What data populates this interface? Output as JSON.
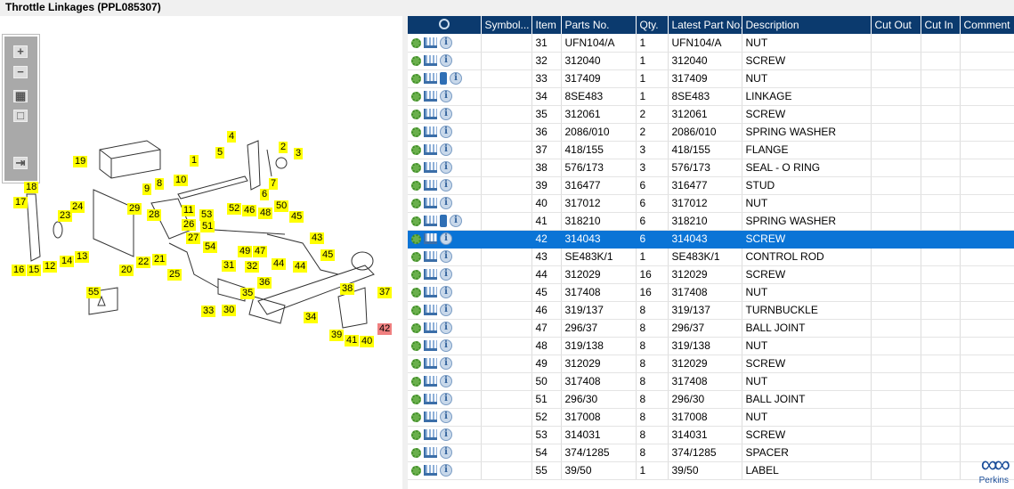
{
  "title": "Throttle Linkages (PPL085307)",
  "tools": {
    "zoom_in": "+",
    "zoom_out": "−",
    "fit": "▦",
    "actual": "□",
    "export": "⇥"
  },
  "callouts": [
    "1",
    "2",
    "3",
    "4",
    "5",
    "6",
    "7",
    "8",
    "9",
    "10",
    "11",
    "12",
    "13",
    "14",
    "15",
    "16",
    "17",
    "18",
    "19",
    "20",
    "21",
    "22",
    "23",
    "24",
    "25",
    "26",
    "27",
    "28",
    "29",
    "30",
    "31",
    "32",
    "33",
    "34",
    "35",
    "36",
    "37",
    "38",
    "39",
    "40",
    "41",
    "42",
    "43",
    "44",
    "44",
    "45",
    "45",
    "46",
    "47",
    "48",
    "49",
    "50",
    "51",
    "52",
    "53",
    "54",
    "55"
  ],
  "selected_callout": "42",
  "columns": [
    "",
    "Symbol...",
    "Item",
    "Parts No.",
    "Qty.",
    "Latest Part No.",
    "Description",
    "Cut Out",
    "Cut In",
    "Comment"
  ],
  "rows": [
    {
      "item": "31",
      "part": "UFN104/A",
      "qty": "1",
      "latest": "UFN104/A",
      "desc": "NUT"
    },
    {
      "item": "32",
      "part": "312040",
      "qty": "1",
      "latest": "312040",
      "desc": "SCREW"
    },
    {
      "item": "33",
      "part": "317409",
      "qty": "1",
      "latest": "317409",
      "desc": "NUT",
      "book": true
    },
    {
      "item": "34",
      "part": "8SE483",
      "qty": "1",
      "latest": "8SE483",
      "desc": "LINKAGE"
    },
    {
      "item": "35",
      "part": "312061",
      "qty": "2",
      "latest": "312061",
      "desc": "SCREW"
    },
    {
      "item": "36",
      "part": "2086/010",
      "qty": "2",
      "latest": "2086/010",
      "desc": "SPRING WASHER"
    },
    {
      "item": "37",
      "part": "418/155",
      "qty": "3",
      "latest": "418/155",
      "desc": "FLANGE"
    },
    {
      "item": "38",
      "part": "576/173",
      "qty": "3",
      "latest": "576/173",
      "desc": "SEAL - O RING"
    },
    {
      "item": "39",
      "part": "316477",
      "qty": "6",
      "latest": "316477",
      "desc": "STUD"
    },
    {
      "item": "40",
      "part": "317012",
      "qty": "6",
      "latest": "317012",
      "desc": "NUT"
    },
    {
      "item": "41",
      "part": "318210",
      "qty": "6",
      "latest": "318210",
      "desc": "SPRING WASHER",
      "book": true
    },
    {
      "item": "42",
      "part": "314043",
      "qty": "6",
      "latest": "314043",
      "desc": "SCREW",
      "selected": true
    },
    {
      "item": "43",
      "part": "SE483K/1",
      "qty": "1",
      "latest": "SE483K/1",
      "desc": "CONTROL ROD"
    },
    {
      "item": "44",
      "part": "312029",
      "qty": "16",
      "latest": "312029",
      "desc": "SCREW"
    },
    {
      "item": "45",
      "part": "317408",
      "qty": "16",
      "latest": "317408",
      "desc": "NUT"
    },
    {
      "item": "46",
      "part": "319/137",
      "qty": "8",
      "latest": "319/137",
      "desc": "TURNBUCKLE"
    },
    {
      "item": "47",
      "part": "296/37",
      "qty": "8",
      "latest": "296/37",
      "desc": "BALL JOINT"
    },
    {
      "item": "48",
      "part": "319/138",
      "qty": "8",
      "latest": "319/138",
      "desc": "NUT"
    },
    {
      "item": "49",
      "part": "312029",
      "qty": "8",
      "latest": "312029",
      "desc": "SCREW"
    },
    {
      "item": "50",
      "part": "317408",
      "qty": "8",
      "latest": "317408",
      "desc": "NUT"
    },
    {
      "item": "51",
      "part": "296/30",
      "qty": "8",
      "latest": "296/30",
      "desc": "BALL JOINT"
    },
    {
      "item": "52",
      "part": "317008",
      "qty": "8",
      "latest": "317008",
      "desc": "NUT"
    },
    {
      "item": "53",
      "part": "314031",
      "qty": "8",
      "latest": "314031",
      "desc": "SCREW"
    },
    {
      "item": "54",
      "part": "374/1285",
      "qty": "8",
      "latest": "374/1285",
      "desc": "SPACER"
    },
    {
      "item": "55",
      "part": "39/50",
      "qty": "1",
      "latest": "39/50",
      "desc": "LABEL"
    }
  ],
  "logo": "Perkins"
}
